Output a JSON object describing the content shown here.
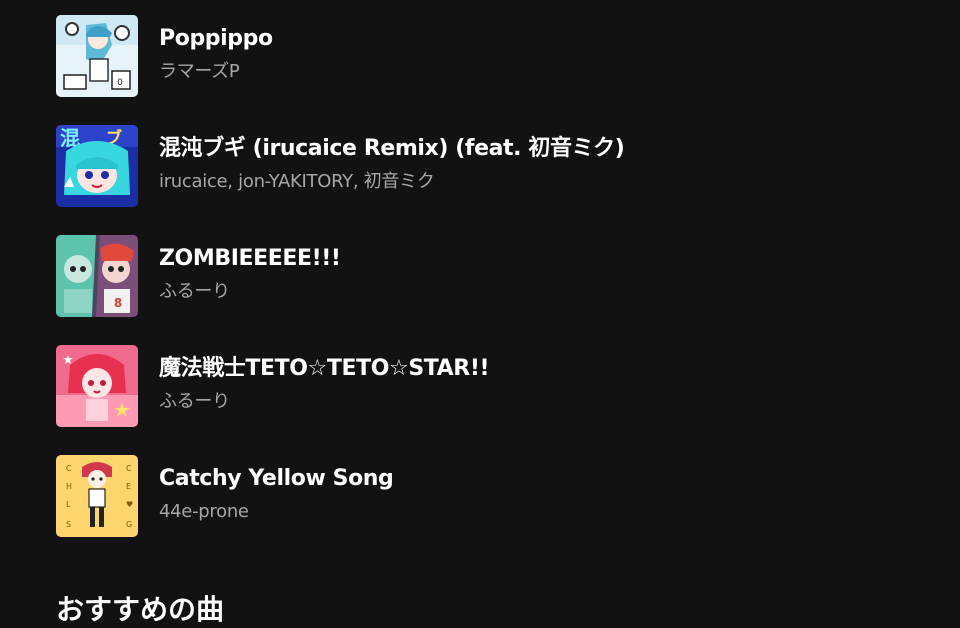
{
  "tracks": [
    {
      "title": "Poppippo",
      "artist": "ラマーズP",
      "cover_icon": "poppippo-cover-art",
      "cover_colors": [
        "#dff3fb",
        "#3a8fb5"
      ]
    },
    {
      "title": "混沌ブギ (irucaice Remix) (feat. 初音ミク)",
      "artist": "irucaice, jon-YAKITORY, 初音ミク",
      "cover_icon": "konton-boogie-cover-art",
      "cover_colors": [
        "#1b2fa8",
        "#39d7e0"
      ]
    },
    {
      "title": "ZOMBIEEEEE!!!",
      "artist": "ふるーり",
      "cover_icon": "zombie-cover-art",
      "cover_colors": [
        "#4a3d5c",
        "#58c2b0"
      ]
    },
    {
      "title": "魔法戦士TETO☆TETO☆STAR!!",
      "artist": "ふるーり",
      "cover_icon": "teto-star-cover-art",
      "cover_colors": [
        "#f26a8d",
        "#ffd1dc"
      ]
    },
    {
      "title": "Catchy Yellow Song",
      "artist": "44e-prone",
      "cover_icon": "catchy-yellow-cover-art",
      "cover_colors": [
        "#ffd56b",
        "#d23a4b"
      ]
    }
  ],
  "section": {
    "title": "おすすめの曲"
  }
}
